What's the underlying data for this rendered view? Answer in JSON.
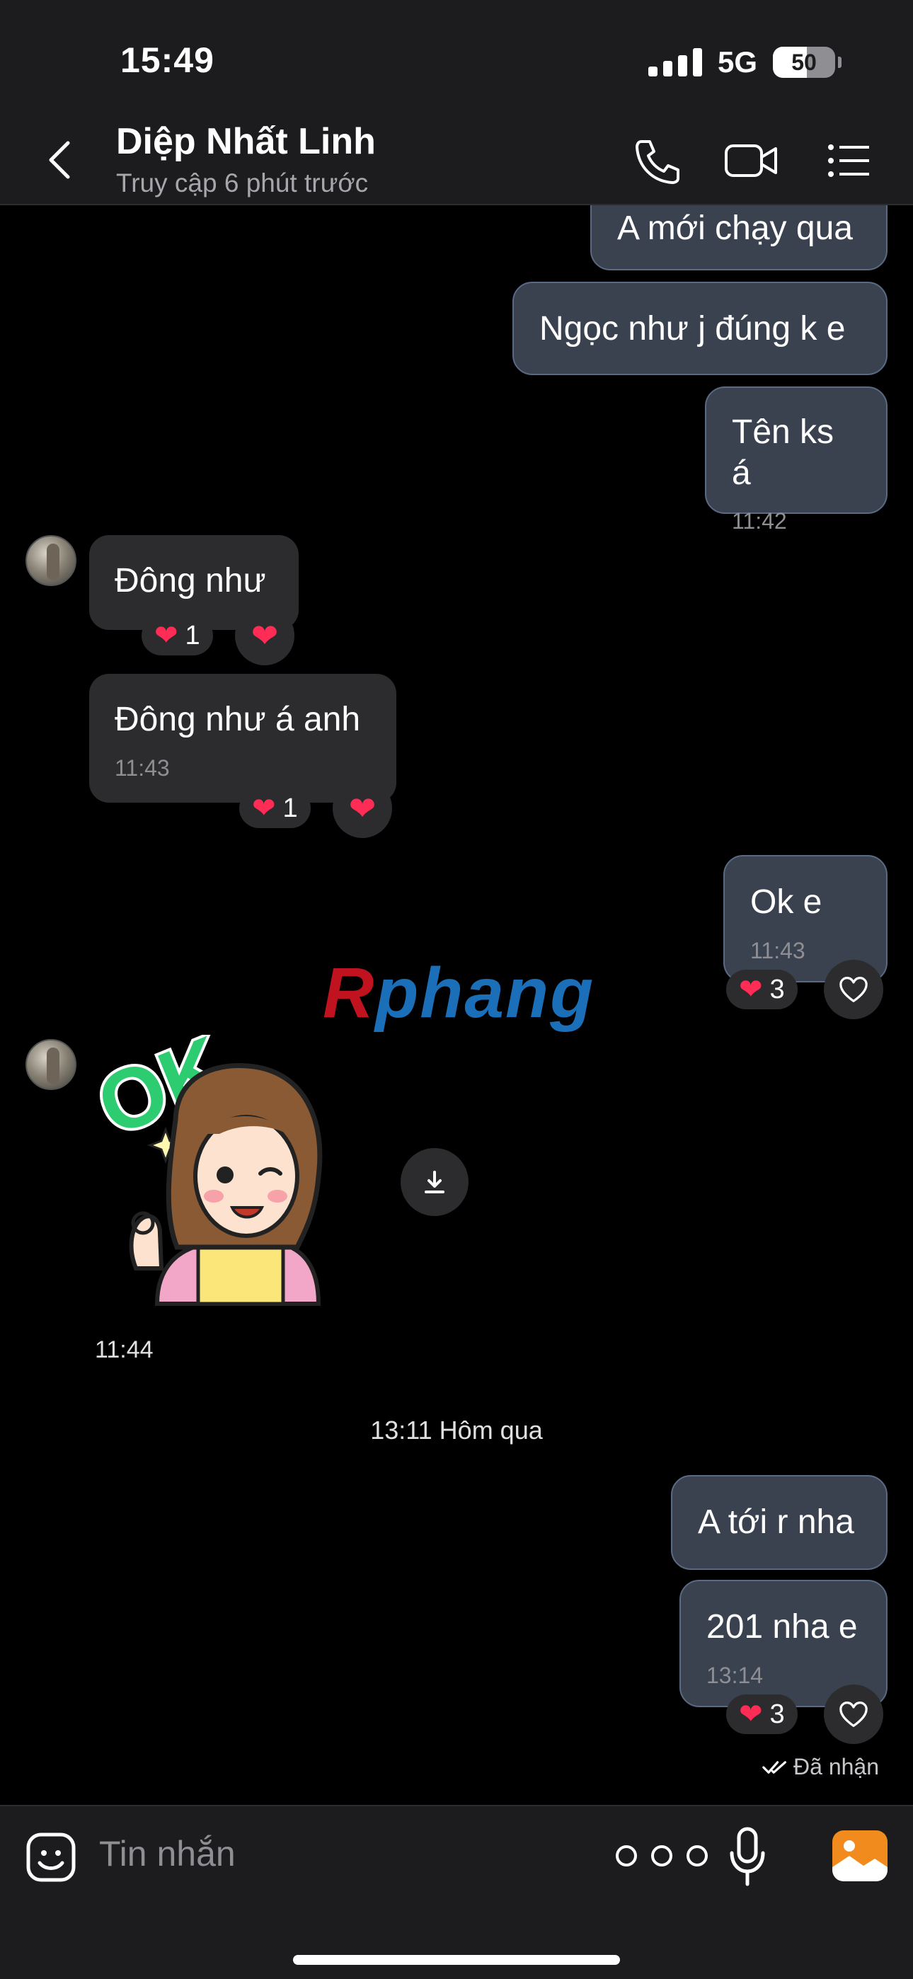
{
  "status_bar": {
    "time": "15:49",
    "network": "5G",
    "battery": "50"
  },
  "header": {
    "contact_name": "Diệp Nhất Linh",
    "contact_status": "Truy cập 6 phút trước",
    "icons": [
      "back-icon",
      "phone-icon",
      "video-icon",
      "menu-list-icon"
    ]
  },
  "messages": [
    {
      "dir": "out",
      "text": "A mới chạy qua"
    },
    {
      "dir": "out",
      "text": "Ngọc như j đúng k e"
    },
    {
      "dir": "out",
      "text": "Tên ks á",
      "time": "11:42"
    },
    {
      "dir": "in",
      "text": "Đông như",
      "reaction_count": "1"
    },
    {
      "dir": "in",
      "text": "Đông như á anh",
      "time": "11:43",
      "reaction_count": "1"
    },
    {
      "dir": "out",
      "text": "Ok e",
      "time": "11:43",
      "reaction_count": "3"
    },
    {
      "dir": "in",
      "type": "sticker",
      "sticker_text": "OK",
      "time": "11:44"
    },
    {
      "dir": "out",
      "text": "A tới r nha"
    },
    {
      "dir": "out",
      "text": "201 nha e",
      "time": "13:14",
      "reaction_count": "3"
    }
  ],
  "watermark": {
    "first": "R",
    "rest": "phang"
  },
  "day_separator": "13:11 Hôm qua",
  "seen_status": "Đã nhận",
  "composer": {
    "placeholder": "Tin nhắn",
    "icons": [
      "emoji-icon",
      "more-icon",
      "microphone-icon",
      "image-icon"
    ]
  },
  "colors": {
    "background": "#000000",
    "outgoing_bubble": "#3a4250",
    "incoming_bubble": "#2c2c2e",
    "heart": "#ff2d55",
    "image_button": "#f28b1e"
  }
}
